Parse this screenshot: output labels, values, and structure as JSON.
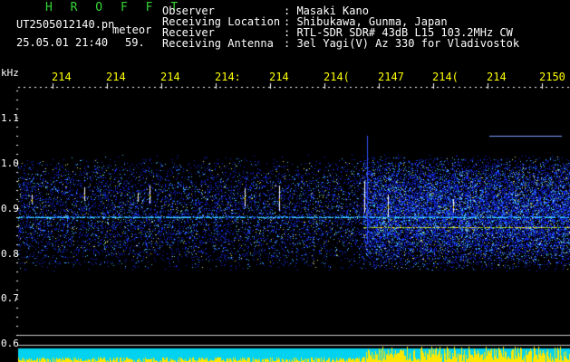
{
  "header": {
    "brand": "H R O F F T",
    "filename": "UT2505012140.pn",
    "station_label": "meteor",
    "datetime": "25.05.01 21:40",
    "count": "59.",
    "fields": [
      {
        "label": "Observer",
        "value": ": Masaki Kano"
      },
      {
        "label": "Receiving Location",
        "value": ": Shibukawa, Gunma, Japan"
      },
      {
        "label": "Receiver",
        "value": ": RTL-SDR SDR# 43dB L15 103.2MHz CW"
      },
      {
        "label": "Receiving Antenna",
        "value": ": 3el Yagi(V) Az 330 for Vladivostok"
      }
    ]
  },
  "chart_data": {
    "type": "heatmap",
    "ylabel": "kHz",
    "y_ticks": [
      "1.1",
      "1.0",
      "0.9",
      "0.8",
      "0.7",
      "0.6"
    ],
    "x_ticks": [
      "214",
      "214",
      "214",
      "214:",
      "214",
      "214(",
      "2147",
      "214(",
      "214",
      "2150"
    ],
    "colors": {
      "background": "#000000",
      "noise_low": "#1a2fff",
      "noise_mid": "#4fd0ff",
      "signal": "#ffd400",
      "bottom_strip": "#00e5ff"
    }
  }
}
